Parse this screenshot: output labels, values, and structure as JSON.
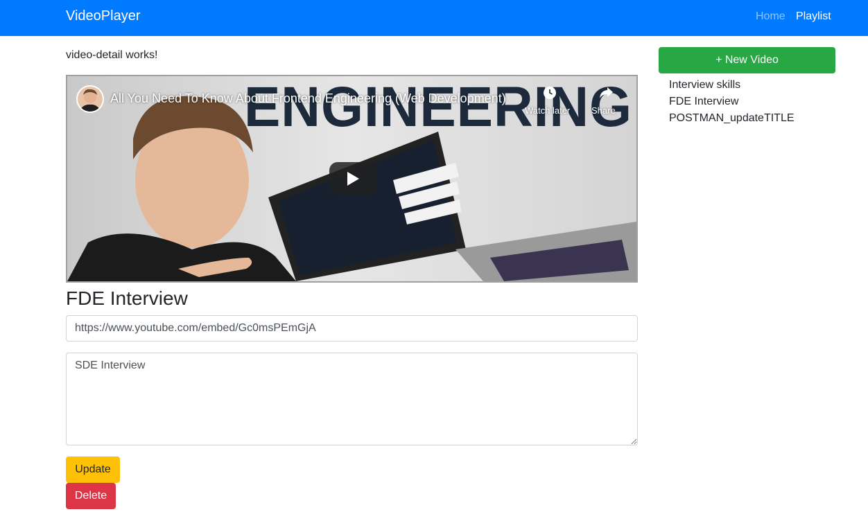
{
  "navbar": {
    "brand": "VideoPlayer",
    "links": [
      {
        "label": "Home",
        "active": false
      },
      {
        "label": "Playlist",
        "active": true
      }
    ],
    "color": "#007bff"
  },
  "main": {
    "works_text": "video-detail works!",
    "video": {
      "title": "All You Need To Know About Frontend Engineering (Web Development)",
      "thumbnail_text": "ENGINEERING",
      "watch_later_label": "Watch later",
      "share_label": "Share",
      "icons": [
        "avatar",
        "clock-icon",
        "share-icon",
        "play-icon"
      ]
    },
    "heading": "FDE Interview",
    "url_value": "https://www.youtube.com/embed/Gc0msPEmGjA",
    "description_value": "SDE Interview",
    "update_label": "Update",
    "delete_label": "Delete"
  },
  "sidebar": {
    "new_video_label": "+ New Video",
    "items": [
      {
        "label": "Interview skills"
      },
      {
        "label": "FDE Interview"
      },
      {
        "label": "POSTMAN_updateTITLE"
      }
    ]
  },
  "colors": {
    "primary": "#007bff",
    "success": "#28a745",
    "warning": "#ffc107",
    "danger": "#dc3545"
  }
}
